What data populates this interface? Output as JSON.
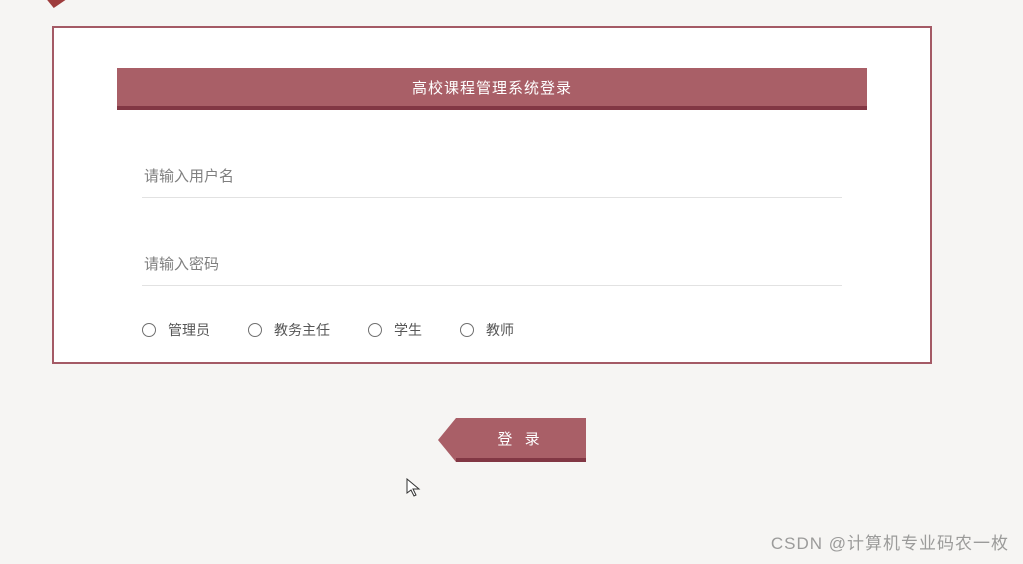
{
  "header": {
    "title": "高校课程管理系统登录"
  },
  "form": {
    "username": {
      "placeholder": "请输入用户名",
      "value": ""
    },
    "password": {
      "placeholder": "请输入密码",
      "value": ""
    },
    "roles": [
      {
        "label": "管理员"
      },
      {
        "label": "教务主任"
      },
      {
        "label": "学生"
      },
      {
        "label": "教师"
      }
    ]
  },
  "login": {
    "label": "登 录"
  },
  "watermark": {
    "text": "CSDN @计算机专业码农一枚"
  }
}
